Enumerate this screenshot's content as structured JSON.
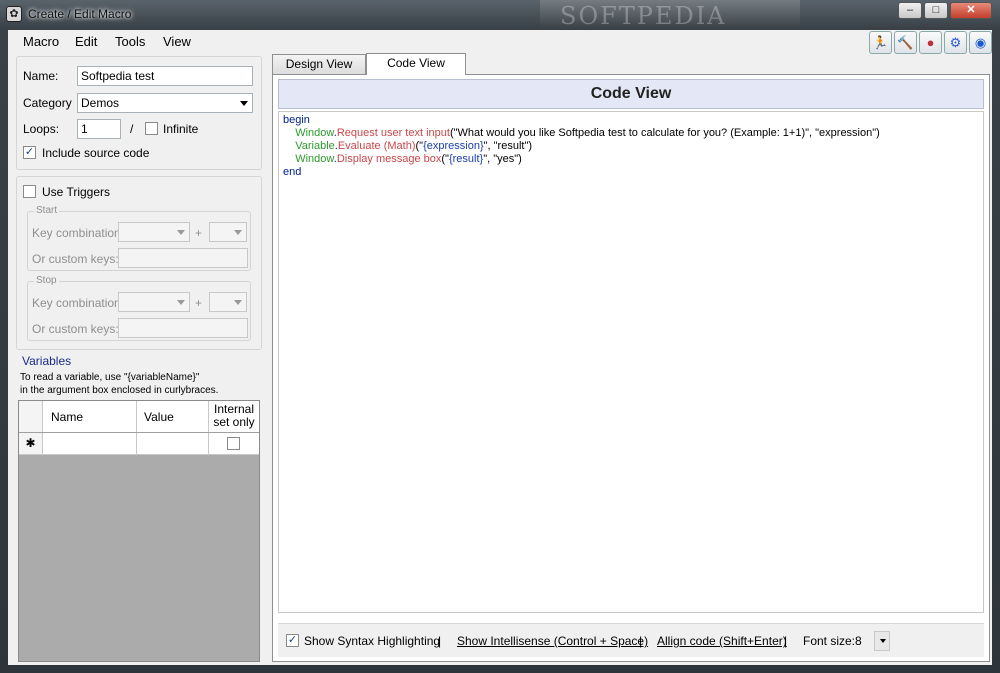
{
  "window": {
    "title": "Create / Edit Macro",
    "watermark": "SOFTPEDIA",
    "controls": {
      "minimize": "–",
      "maximize": "□",
      "close": "✕"
    }
  },
  "menu": [
    "Macro",
    "Edit",
    "Tools",
    "View"
  ],
  "toolbar_icons": [
    "run-icon",
    "hammer-icon",
    "record-icon",
    "settings-icon",
    "help-icon"
  ],
  "settings": {
    "name_label": "Name:",
    "name_value": "Softpedia test",
    "category_label": "Category",
    "category_value": "Demos",
    "loops_label": "Loops:",
    "loops_value": "1",
    "loops_sep": "/",
    "infinite_label": "Infinite",
    "include_source_label": "Include source code",
    "include_source_checked": true
  },
  "triggers": {
    "use_triggers_label": "Use Triggers",
    "start_title": "Start",
    "stop_title": "Stop",
    "key_combination_label": "Key combination:",
    "plus": "+",
    "custom_keys_label": "Or custom keys:"
  },
  "variables": {
    "title": "Variables",
    "hint_line1": "To read a variable, use \"{variableName}\"",
    "hint_line2": "in the argument box enclosed in curlybraces.",
    "columns": [
      "Name",
      "Value",
      "Internal set only"
    ],
    "new_row_marker": "✱"
  },
  "tabs": [
    "Design View",
    "Code View"
  ],
  "active_tab": "Code View",
  "code_view": {
    "header": "Code View",
    "lines": [
      [
        {
          "t": "begin",
          "c": "kw"
        }
      ],
      [
        {
          "t": "    ",
          "c": ""
        },
        {
          "t": "Window",
          "c": "obj"
        },
        {
          "t": ".",
          "c": "kw"
        },
        {
          "t": "Request user text input",
          "c": "fn"
        },
        {
          "t": "(\"What would you like Softpedia test to calculate for you? (Example: 1+1)\", \"expression\")",
          "c": ""
        }
      ],
      [
        {
          "t": "    ",
          "c": ""
        },
        {
          "t": "Variable",
          "c": "obj"
        },
        {
          "t": ".",
          "c": "kw"
        },
        {
          "t": "Evaluate (Math)",
          "c": "fn"
        },
        {
          "t": "(\"",
          "c": ""
        },
        {
          "t": "{expression}",
          "c": "var"
        },
        {
          "t": "\", \"result\")",
          "c": ""
        }
      ],
      [
        {
          "t": "    ",
          "c": ""
        },
        {
          "t": "Window",
          "c": "obj"
        },
        {
          "t": ".",
          "c": "kw"
        },
        {
          "t": "Display message box",
          "c": "fn"
        },
        {
          "t": "(\"",
          "c": ""
        },
        {
          "t": "{result}",
          "c": "var"
        },
        {
          "t": "\", \"yes\")",
          "c": ""
        }
      ],
      [
        {
          "t": "end",
          "c": "kw"
        }
      ]
    ]
  },
  "bottom": {
    "syntax_label": "Show Syntax Highlighting",
    "syntax_checked": true,
    "intellisense_label": "Show Intellisense (Control + Space)",
    "align_label": "Allign code (Shift+Enter)",
    "font_size_label": "Font size:",
    "font_size_value": "8",
    "separator": "|"
  }
}
